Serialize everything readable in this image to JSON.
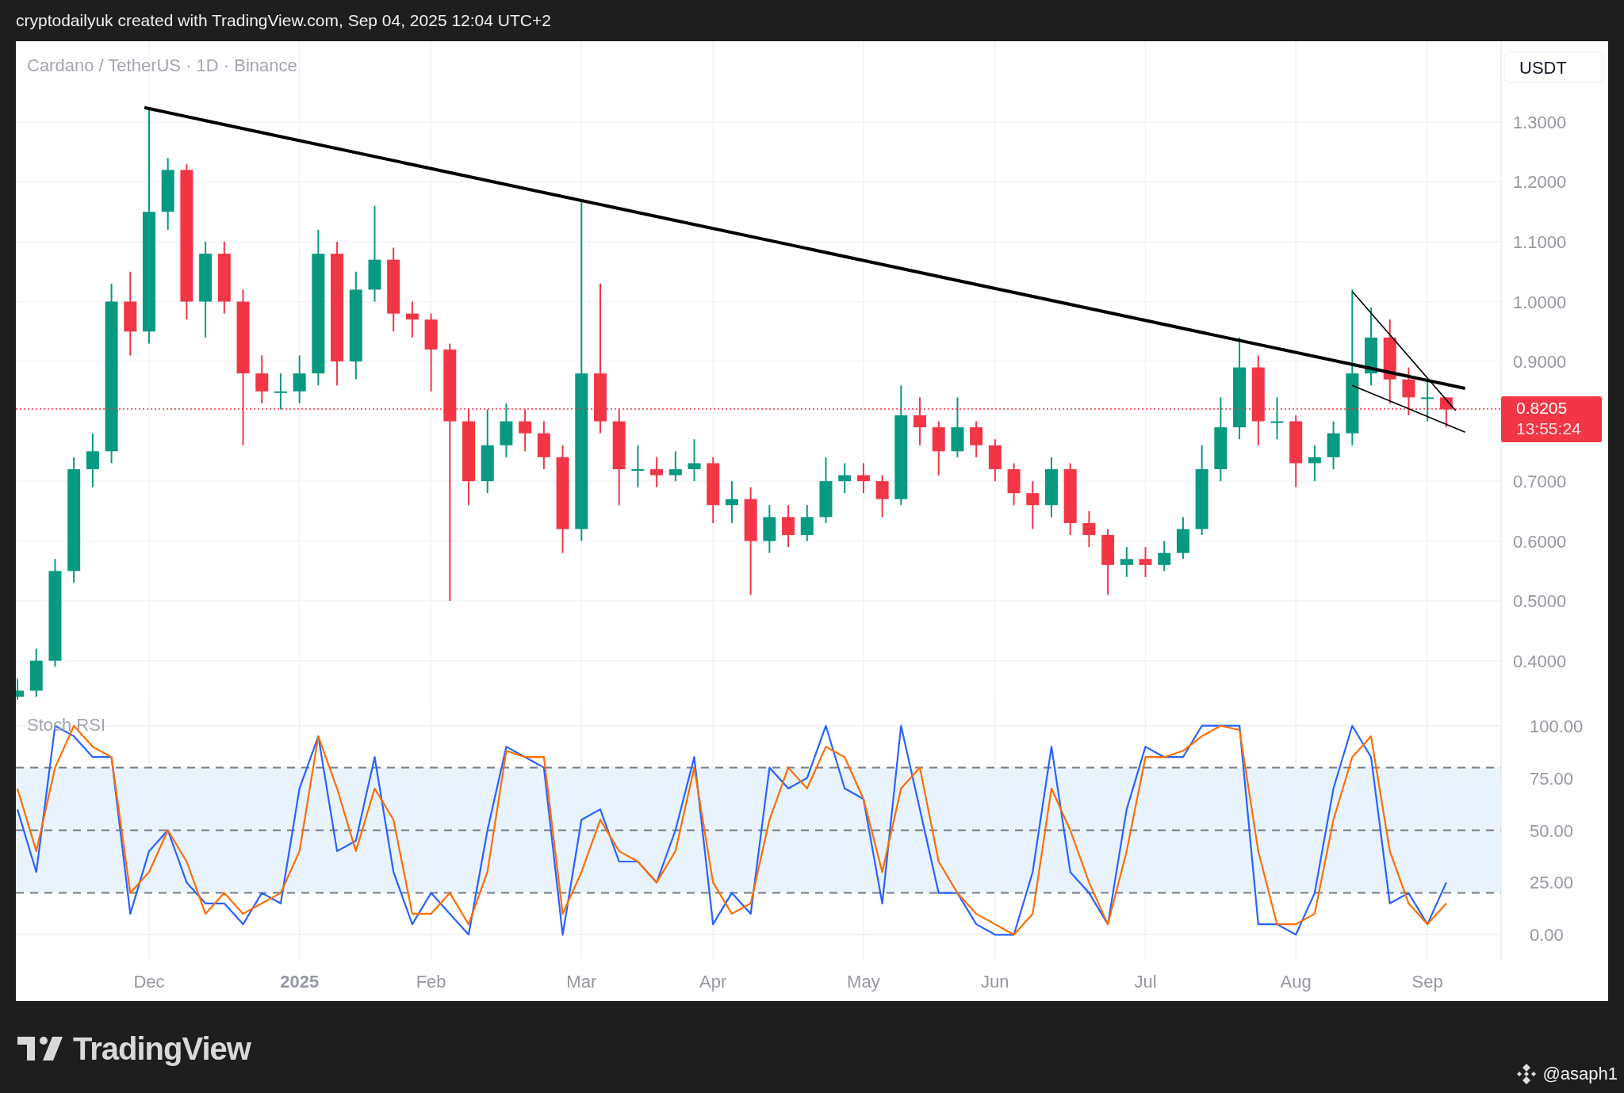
{
  "header": {
    "caption": "cryptodailyuk created with TradingView.com, Sep 04, 2025 12:04 UTC+2"
  },
  "price_pane": {
    "currency_button": "USDT",
    "countdown": "13:55:24",
    "chart_data": {
      "type": "candlestick",
      "title": "Cardano / TetherUS · 1D · Binance",
      "grid": true,
      "ylim": [
        0.332,
        1.435
      ],
      "yticks": [
        {
          "value": 1.3,
          "label": "1.3000"
        },
        {
          "value": 1.2,
          "label": "1.2000"
        },
        {
          "value": 1.1,
          "label": "1.1000"
        },
        {
          "value": 1.0,
          "label": "1.0000"
        },
        {
          "value": 0.9,
          "label": "0.9000"
        },
        {
          "value": 0.7,
          "label": "0.7000"
        },
        {
          "value": 0.6,
          "label": "0.6000"
        },
        {
          "value": 0.5,
          "label": "0.5000"
        },
        {
          "value": 0.4,
          "label": "0.4000"
        }
      ],
      "ohlc": [
        [
          0.34,
          0.37,
          0.335,
          0.35
        ],
        [
          0.35,
          0.42,
          0.34,
          0.4
        ],
        [
          0.4,
          0.57,
          0.39,
          0.55
        ],
        [
          0.55,
          0.74,
          0.53,
          0.72
        ],
        [
          0.72,
          0.78,
          0.69,
          0.75
        ],
        [
          0.75,
          1.03,
          0.73,
          1.0
        ],
        [
          1.0,
          1.05,
          0.91,
          0.95
        ],
        [
          0.95,
          1.32,
          0.93,
          1.15
        ],
        [
          1.15,
          1.24,
          1.12,
          1.22
        ],
        [
          1.22,
          1.23,
          0.97,
          1.0
        ],
        [
          1.0,
          1.1,
          0.94,
          1.08
        ],
        [
          1.08,
          1.1,
          0.98,
          1.0
        ],
        [
          1.0,
          1.02,
          0.76,
          0.88
        ],
        [
          0.88,
          0.91,
          0.83,
          0.85
        ],
        [
          0.85,
          0.88,
          0.82,
          0.85
        ],
        [
          0.85,
          0.91,
          0.83,
          0.88
        ],
        [
          0.88,
          1.12,
          0.86,
          1.08
        ],
        [
          1.08,
          1.1,
          0.86,
          0.9
        ],
        [
          0.9,
          1.05,
          0.87,
          1.02
        ],
        [
          1.02,
          1.16,
          1.0,
          1.07
        ],
        [
          1.07,
          1.09,
          0.95,
          0.98
        ],
        [
          0.98,
          1.0,
          0.94,
          0.97
        ],
        [
          0.97,
          0.98,
          0.85,
          0.92
        ],
        [
          0.92,
          0.93,
          0.5,
          0.8
        ],
        [
          0.8,
          0.82,
          0.66,
          0.7
        ],
        [
          0.7,
          0.82,
          0.68,
          0.76
        ],
        [
          0.76,
          0.83,
          0.74,
          0.8
        ],
        [
          0.8,
          0.82,
          0.75,
          0.78
        ],
        [
          0.78,
          0.8,
          0.72,
          0.74
        ],
        [
          0.74,
          0.76,
          0.58,
          0.62
        ],
        [
          0.62,
          1.17,
          0.6,
          0.88
        ],
        [
          0.88,
          1.03,
          0.78,
          0.8
        ],
        [
          0.8,
          0.82,
          0.66,
          0.72
        ],
        [
          0.72,
          0.76,
          0.69,
          0.72
        ],
        [
          0.72,
          0.74,
          0.69,
          0.71
        ],
        [
          0.71,
          0.75,
          0.7,
          0.72
        ],
        [
          0.72,
          0.77,
          0.7,
          0.73
        ],
        [
          0.73,
          0.74,
          0.63,
          0.66
        ],
        [
          0.66,
          0.7,
          0.63,
          0.67
        ],
        [
          0.67,
          0.69,
          0.51,
          0.6
        ],
        [
          0.6,
          0.66,
          0.58,
          0.64
        ],
        [
          0.64,
          0.66,
          0.59,
          0.61
        ],
        [
          0.61,
          0.66,
          0.6,
          0.64
        ],
        [
          0.64,
          0.74,
          0.63,
          0.7
        ],
        [
          0.7,
          0.73,
          0.68,
          0.71
        ],
        [
          0.71,
          0.73,
          0.68,
          0.7
        ],
        [
          0.7,
          0.71,
          0.64,
          0.67
        ],
        [
          0.67,
          0.86,
          0.66,
          0.81
        ],
        [
          0.81,
          0.84,
          0.76,
          0.79
        ],
        [
          0.79,
          0.8,
          0.71,
          0.75
        ],
        [
          0.75,
          0.84,
          0.74,
          0.79
        ],
        [
          0.79,
          0.8,
          0.74,
          0.76
        ],
        [
          0.76,
          0.77,
          0.7,
          0.72
        ],
        [
          0.72,
          0.73,
          0.66,
          0.68
        ],
        [
          0.68,
          0.7,
          0.62,
          0.66
        ],
        [
          0.66,
          0.74,
          0.64,
          0.72
        ],
        [
          0.72,
          0.73,
          0.61,
          0.63
        ],
        [
          0.63,
          0.65,
          0.59,
          0.61
        ],
        [
          0.61,
          0.62,
          0.51,
          0.56
        ],
        [
          0.56,
          0.59,
          0.54,
          0.57
        ],
        [
          0.57,
          0.59,
          0.54,
          0.56
        ],
        [
          0.56,
          0.6,
          0.55,
          0.58
        ],
        [
          0.58,
          0.64,
          0.57,
          0.62
        ],
        [
          0.62,
          0.76,
          0.61,
          0.72
        ],
        [
          0.72,
          0.84,
          0.7,
          0.79
        ],
        [
          0.79,
          0.94,
          0.77,
          0.89
        ],
        [
          0.89,
          0.91,
          0.76,
          0.8
        ],
        [
          0.8,
          0.84,
          0.77,
          0.8
        ],
        [
          0.8,
          0.81,
          0.69,
          0.73
        ],
        [
          0.73,
          0.76,
          0.7,
          0.74
        ],
        [
          0.74,
          0.8,
          0.72,
          0.78
        ],
        [
          0.78,
          1.02,
          0.76,
          0.88
        ],
        [
          0.88,
          0.99,
          0.86,
          0.94
        ],
        [
          0.94,
          0.97,
          0.83,
          0.87
        ],
        [
          0.87,
          0.89,
          0.81,
          0.84
        ],
        [
          0.84,
          0.87,
          0.8,
          0.84
        ],
        [
          0.84,
          0.84,
          0.79,
          0.82
        ]
      ],
      "ref_lines": [
        {
          "axis": "y",
          "value": 0.8205,
          "label": "0.8205",
          "color": "#f23645"
        }
      ]
    }
  },
  "rsi_pane": {
    "chart_data": {
      "type": "line",
      "title": "Stoch RSI",
      "grid": true,
      "ylim": [
        -11.65,
        111.65
      ],
      "categories": [
        null,
        null,
        null,
        null,
        null,
        null,
        null,
        "Dec",
        null,
        null,
        null,
        null,
        null,
        null,
        null,
        "2025",
        null,
        null,
        null,
        null,
        null,
        null,
        "Feb",
        null,
        null,
        null,
        null,
        null,
        null,
        null,
        "Mar",
        null,
        null,
        null,
        null,
        null,
        null,
        "Apr",
        null,
        null,
        null,
        null,
        null,
        null,
        null,
        "May",
        null,
        null,
        null,
        null,
        null,
        null,
        "Jun",
        null,
        null,
        null,
        null,
        null,
        null,
        null,
        "Jul",
        null,
        null,
        null,
        null,
        null,
        null,
        null,
        "Aug",
        null,
        null,
        null,
        null,
        null,
        null,
        "Sep",
        null
      ],
      "yticks": [
        {
          "value": 100,
          "label": "100.00"
        },
        {
          "value": 75,
          "label": "75.00"
        },
        {
          "value": 50,
          "label": "50.00"
        },
        {
          "value": 25,
          "label": "25.00"
        },
        {
          "value": 0,
          "label": "0.00"
        }
      ],
      "series": [
        {
          "color": "#2962ff",
          "values": [
            60,
            30,
            100,
            95,
            85,
            85,
            10,
            40,
            50,
            25,
            15,
            15,
            5,
            20,
            15,
            70,
            95,
            40,
            45,
            85,
            30,
            5,
            20,
            10,
            0,
            50,
            90,
            85,
            80,
            0,
            55,
            60,
            35,
            35,
            25,
            50,
            85,
            5,
            20,
            10,
            80,
            70,
            75,
            100,
            70,
            65,
            15,
            100,
            60,
            20,
            20,
            5,
            0,
            0,
            30,
            90,
            30,
            20,
            5,
            60,
            90,
            85,
            85,
            100,
            100,
            100,
            5,
            5,
            0,
            20,
            70,
            100,
            85,
            15,
            20,
            5,
            25
          ]
        },
        {
          "color": "#ff6d00",
          "values": [
            70,
            40,
            80,
            100,
            90,
            85,
            20,
            30,
            50,
            35,
            10,
            20,
            10,
            15,
            20,
            40,
            95,
            70,
            40,
            70,
            55,
            10,
            10,
            20,
            5,
            30,
            88,
            85,
            85,
            10,
            30,
            55,
            40,
            35,
            25,
            40,
            80,
            25,
            10,
            15,
            55,
            80,
            70,
            90,
            85,
            65,
            30,
            70,
            80,
            35,
            20,
            10,
            5,
            0,
            10,
            70,
            50,
            25,
            5,
            40,
            85,
            85,
            88,
            95,
            100,
            98,
            40,
            5,
            5,
            10,
            55,
            85,
            95,
            40,
            15,
            5,
            15
          ]
        }
      ],
      "ref_lines": [
        {
          "axis": "y",
          "value": 80
        },
        {
          "axis": "y",
          "value": 50
        },
        {
          "axis": "y",
          "value": 20
        }
      ],
      "bands": [
        {
          "axis": "y",
          "from": 20,
          "to": 80
        }
      ]
    }
  },
  "footer": {
    "brand": "TradingView",
    "author": "@asaph1"
  }
}
